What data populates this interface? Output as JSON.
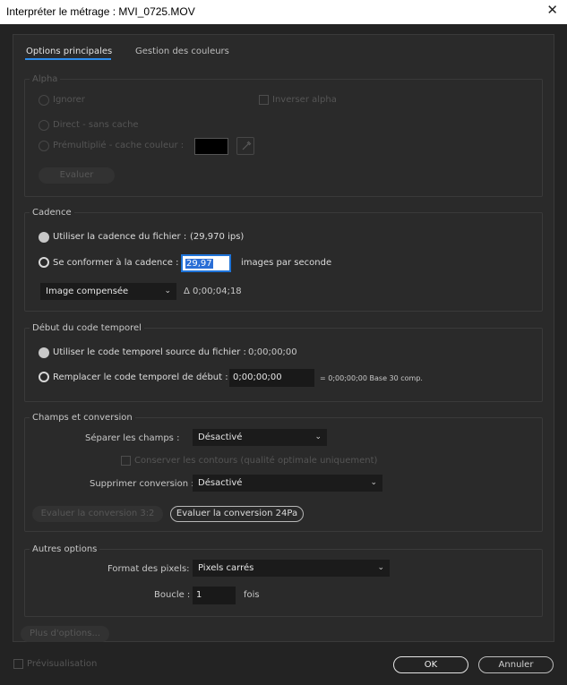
{
  "window": {
    "title": "Interpréter le métrage : MVI_0725.MOV"
  },
  "tabs": {
    "main": "Options principales",
    "color": "Gestion des couleurs"
  },
  "alpha": {
    "title": "Alpha",
    "ignore": "Ignorer",
    "invert": "Inverser alpha",
    "direct": "Direct - sans cache",
    "premult": "Prémultiplié - cache couleur :",
    "evaluate": "Evaluer"
  },
  "cadence": {
    "title": "Cadence",
    "use_file": "Utiliser la cadence du fichier :",
    "file_rate": "(29,970 ips)",
    "conform": "Se conformer à la cadence :",
    "rate_value": "29,97",
    "fps_label": "images par seconde",
    "comp_mode": "Image compensée",
    "duration": "Δ 0;00;04;18"
  },
  "timecode": {
    "title": "Début du code temporel",
    "use_source": "Utiliser le code temporel source du fichier :",
    "source_value": "0;00;00;00",
    "replace": "Remplacer le code temporel de début :",
    "replace_value": "0;00;00;00",
    "info": "= 0;00;00;00  Base 30  comp."
  },
  "fields": {
    "title": "Champs et conversion",
    "separate_label": "Séparer les champs :",
    "separate_value": "Désactivé",
    "preserve": "Conserver les contours (qualité optimale uniquement)",
    "remove_label": "Supprimer conversion :",
    "remove_value": "Désactivé",
    "eval_32": "Evaluer la conversion 3:2",
    "eval_24pa": "Evaluer la conversion 24Pa"
  },
  "other": {
    "title": "Autres options",
    "pixel_label": "Format des pixels:",
    "pixel_value": "Pixels carrés",
    "loop_label": "Boucle :",
    "loop_value": "1",
    "loop_unit": "fois"
  },
  "more_options": "Plus d'options...",
  "preview": "Prévisualisation",
  "buttons": {
    "ok": "OK",
    "cancel": "Annuler"
  },
  "colors": {
    "accent": "#2d8ceb",
    "background": "#232323",
    "panel": "#2a2a2a"
  }
}
